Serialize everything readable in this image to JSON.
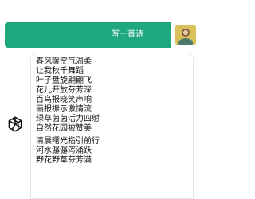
{
  "user_message": {
    "text": "写一首诗"
  },
  "bot_message": {
    "stanza_1": [
      "春风暖空气温柔",
      "让我秋千舞蹈",
      "叶子盘旋翩翩飞",
      "花儿开放芬芳深",
      "百鸟报晓笑声响",
      "画报振示激情流",
      "绿草茵茵活力四射",
      "自然花园被赞美"
    ],
    "stanza_2": [
      "清晨曙光指引前行",
      "河水潺潺泻涌跃",
      "野花野草芬芳满"
    ]
  },
  "icons": {
    "user_avatar": "user-avatar",
    "assistant": "openai-logo-icon"
  },
  "colors": {
    "user_bubble": "#1fa77f",
    "avatar_bg": "#d9c25b"
  }
}
